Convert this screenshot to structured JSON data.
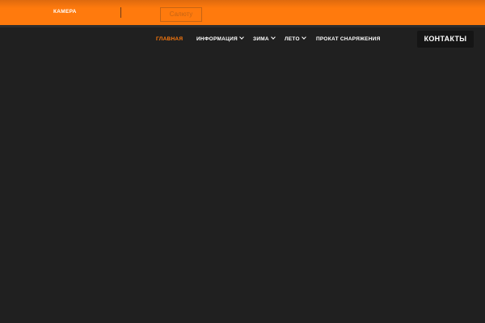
{
  "topbar": {
    "camera_label": "КАМЕРА",
    "logo_text": "Салюту",
    "accent_color": "#ff7a0d"
  },
  "nav": {
    "items": [
      {
        "label": "ГЛАВНАЯ",
        "active": true,
        "has_dropdown": false
      },
      {
        "label": "ИНФОРМАЦИЯ",
        "active": false,
        "has_dropdown": true
      },
      {
        "label": "ЗИМА",
        "active": false,
        "has_dropdown": true
      },
      {
        "label": "ЛЕТО",
        "active": false,
        "has_dropdown": true
      },
      {
        "label": "ПРОКАТ СНАРЯЖЕНИЯ",
        "active": false,
        "has_dropdown": false
      }
    ],
    "contacts_label": "КОНТАКТЫ"
  }
}
